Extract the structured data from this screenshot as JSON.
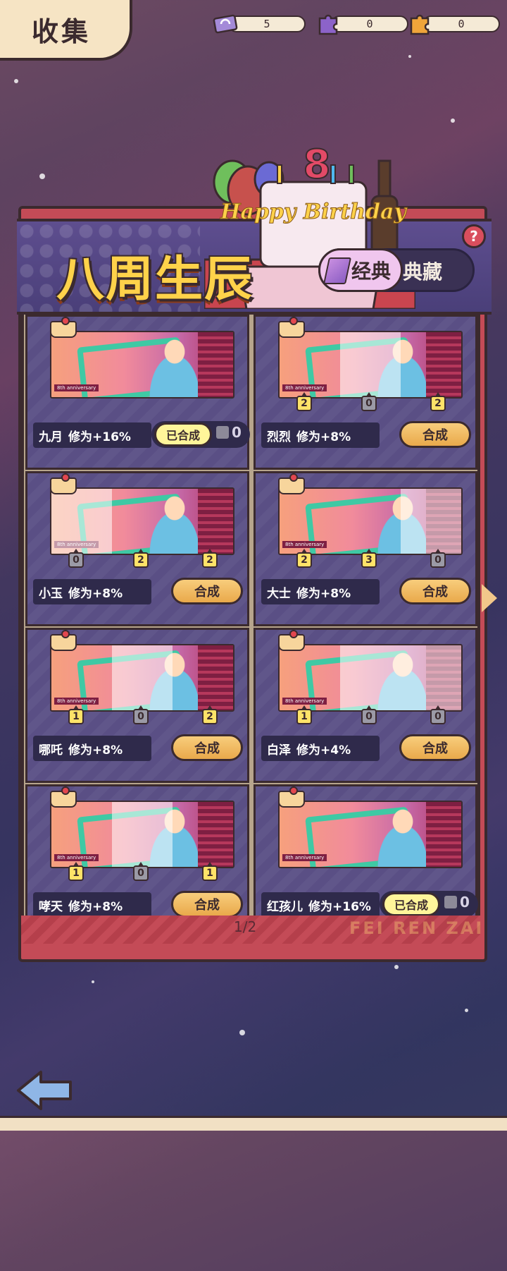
{
  "page": {
    "title": "收集"
  },
  "resources": [
    {
      "name": "ticket",
      "value": "5",
      "color": "#a48ad8"
    },
    {
      "name": "puzzle-purple",
      "value": "0",
      "color": "#8c63c9"
    },
    {
      "name": "puzzle-orange",
      "value": "0",
      "color": "#f0a53a"
    }
  ],
  "event": {
    "title": "八周生辰",
    "cake_text": "Happy Birthday",
    "help": "?",
    "tabs": {
      "classic": "经典",
      "collection": "典藏"
    }
  },
  "cards": [
    {
      "name": "九月",
      "bonus": "修为+16%",
      "status": "done",
      "done_label": "已合成",
      "piece_count": "0",
      "pieces": []
    },
    {
      "name": "烈烈",
      "bonus": "修为+8%",
      "status": "synth",
      "button": "合成",
      "pieces": [
        "2",
        "0",
        "2"
      ]
    },
    {
      "name": "小玉",
      "bonus": "修为+8%",
      "status": "synth",
      "button": "合成",
      "pieces": [
        "0",
        "2",
        "2"
      ]
    },
    {
      "name": "大士",
      "bonus": "修为+8%",
      "status": "synth",
      "button": "合成",
      "pieces": [
        "2",
        "3",
        "0"
      ]
    },
    {
      "name": "哪吒",
      "bonus": "修为+8%",
      "status": "synth",
      "button": "合成",
      "pieces": [
        "1",
        "0",
        "2"
      ]
    },
    {
      "name": "白泽",
      "bonus": "修为+4%",
      "status": "synth",
      "button": "合成",
      "pieces": [
        "1",
        "0",
        "0"
      ]
    },
    {
      "name": "哮天",
      "bonus": "修为+8%",
      "status": "synth",
      "button": "合成",
      "pieces": [
        "1",
        "0",
        "1"
      ]
    },
    {
      "name": "红孩儿",
      "bonus": "修为+16%",
      "status": "done",
      "done_label": "已合成",
      "piece_count": "0",
      "pieces": []
    }
  ],
  "card_art_tag": "8th anniversary",
  "pagination": {
    "label": "1/2"
  },
  "watermark": "FEI REN ZAI",
  "colors": {
    "gold": "#ffd24a",
    "panel_red": "#c44b57",
    "card_purple": "#5a4f85",
    "button_orange": "#e9a94b"
  }
}
